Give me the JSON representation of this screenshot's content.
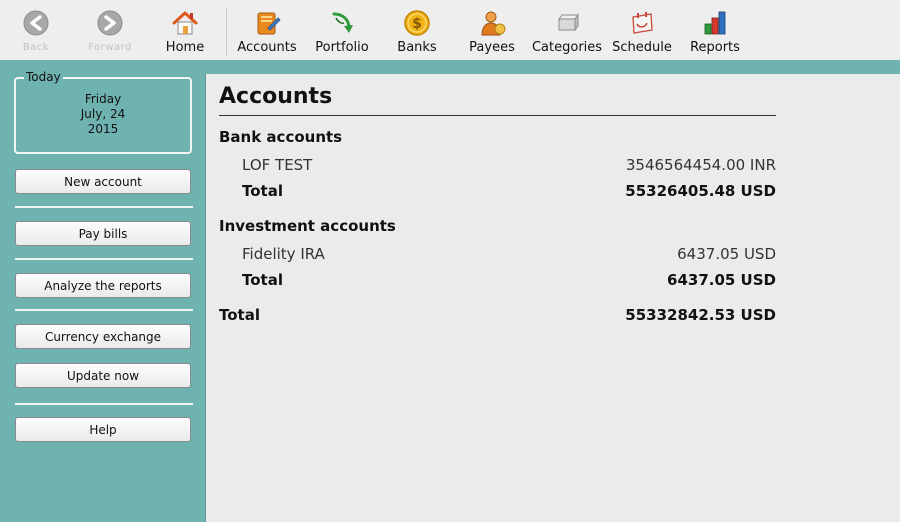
{
  "toolbar": {
    "buttons": [
      {
        "id": "back",
        "label": "Back",
        "icon": "back-arrow-icon",
        "enabled": false
      },
      {
        "id": "forward",
        "label": "Forward",
        "icon": "forward-arrow-icon",
        "enabled": false
      },
      {
        "id": "home",
        "label": "Home",
        "icon": "home-icon",
        "enabled": true
      },
      {
        "id": "accounts",
        "label": "Accounts",
        "icon": "accounts-book-icon",
        "enabled": true
      },
      {
        "id": "portfolio",
        "label": "Portfolio",
        "icon": "portfolio-icon",
        "enabled": true
      },
      {
        "id": "banks",
        "label": "Banks",
        "icon": "dollar-coin-icon",
        "enabled": true
      },
      {
        "id": "payees",
        "label": "Payees",
        "icon": "payee-person-icon",
        "enabled": true
      },
      {
        "id": "categories",
        "label": "Categories",
        "icon": "categories-icon",
        "enabled": true
      },
      {
        "id": "schedule",
        "label": "Schedule",
        "icon": "schedule-icon",
        "enabled": true
      },
      {
        "id": "reports",
        "label": "Reports",
        "icon": "bar-chart-icon",
        "enabled": true
      }
    ]
  },
  "sidebar": {
    "today": {
      "legend": "Today",
      "weekday": "Friday",
      "month_day": "July, 24",
      "year": "2015"
    },
    "buttons": {
      "new_account": "New account",
      "pay_bills": "Pay bills",
      "analyze_reports": "Analyze the reports",
      "currency_exchange": "Currency exchange",
      "update_now": "Update now",
      "help": "Help"
    }
  },
  "main": {
    "title": "Accounts",
    "bank": {
      "heading": "Bank accounts",
      "accounts": [
        {
          "name": "LOF TEST",
          "amount": "3546564454.00 INR"
        }
      ],
      "total_label": "Total",
      "total": "55326405.48 USD"
    },
    "investment": {
      "heading": "Investment accounts",
      "accounts": [
        {
          "name": "Fidelity IRA",
          "amount": "6437.05 USD"
        }
      ],
      "total_label": "Total",
      "total": "6437.05 USD"
    },
    "grand_total_label": "Total",
    "grand_total": "55332842.53 USD"
  },
  "colors": {
    "sidebar": "#6fb3b1",
    "content_bg": "#ebebeb",
    "toolbar_bg": "#eeeeee"
  }
}
